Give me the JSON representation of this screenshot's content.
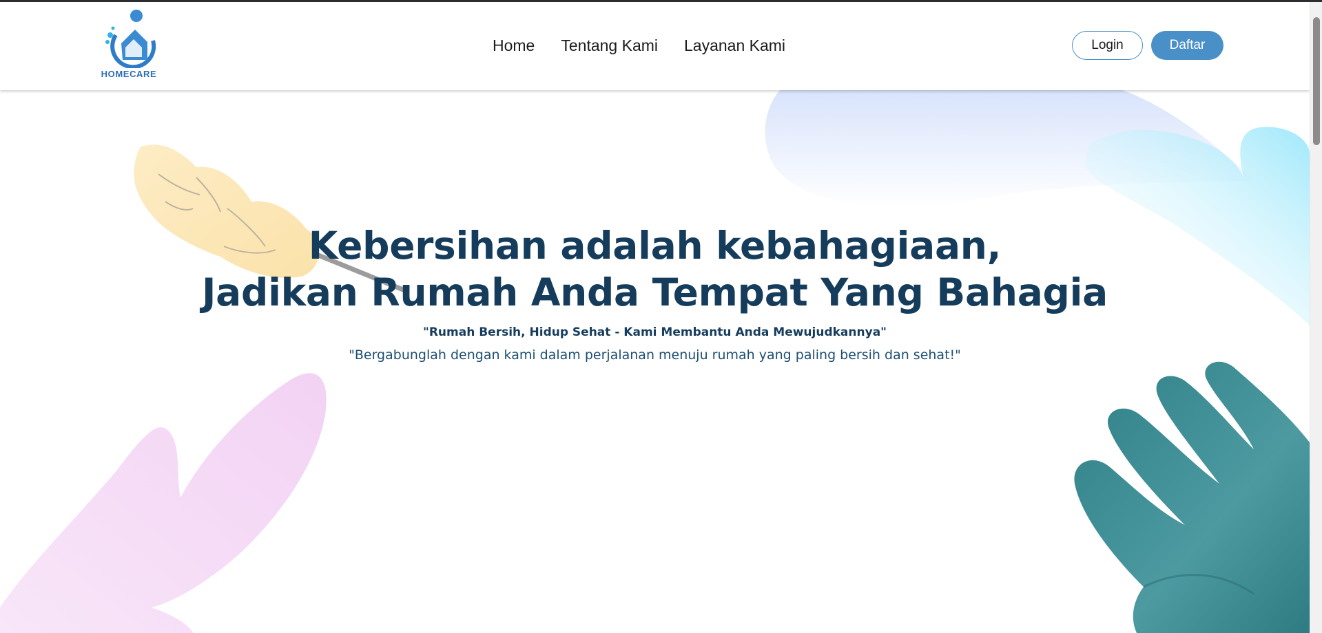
{
  "brand": {
    "name": "HOMECARE",
    "logo_icon": "homecare-logo-icon",
    "primary_color": "#4a90c8",
    "heading_color": "#163c5c"
  },
  "nav": {
    "links": [
      {
        "label": "Home"
      },
      {
        "label": "Tentang Kami"
      },
      {
        "label": "Layanan Kami"
      }
    ],
    "login_label": "Login",
    "register_label": "Daftar"
  },
  "hero": {
    "title_line1": "Kebersihan adalah kebahagiaan,",
    "title_line2": "Jadikan Rumah Anda Tempat Yang Bahagia",
    "subtitle": "\"Rumah Bersih, Hidup Sehat - Kami Membantu Anda Mewujudkannya\"",
    "description": "\"Bergabunglah dengan kami dalam perjalanan menuju rumah yang paling bersih dan sehat!\"",
    "decorations": [
      "feather-duster-icon",
      "pink-glove-icon",
      "teal-glove-icon",
      "blue-glove-icon"
    ]
  }
}
